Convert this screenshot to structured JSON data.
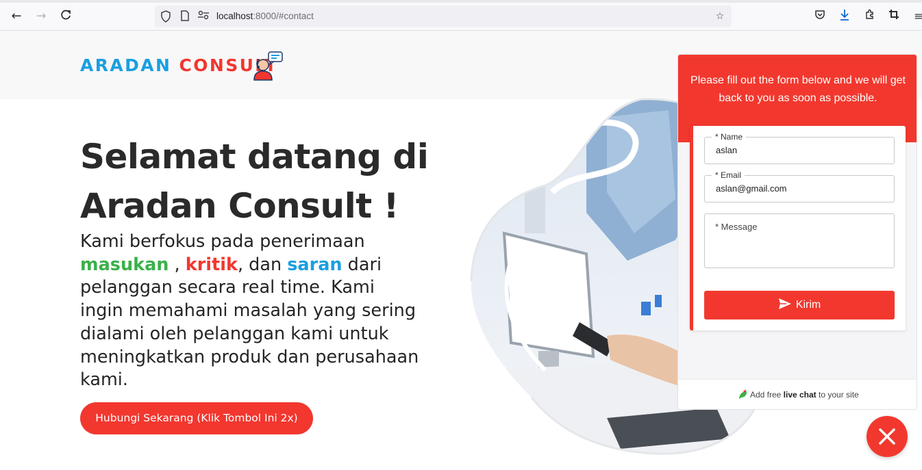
{
  "browser": {
    "url_host": "localhost",
    "url_rest": ":8000/#contact",
    "icons": [
      "back-icon",
      "forward-icon",
      "reload-icon",
      "shield-icon",
      "page-icon",
      "permissions-icon",
      "bookmark-star-icon",
      "pocket-icon",
      "download-icon",
      "extensions-icon",
      "screenshot-icon",
      "menu-icon"
    ]
  },
  "header": {
    "logo_part1": "ARADAN",
    "logo_part2": "CONSULT"
  },
  "hero": {
    "title": "Selamat datang di Aradan Consult !",
    "body_intro": "Kami berfokus pada penerimaan ",
    "kw1": "masukan",
    "sep1": " , ",
    "kw2": "kritik",
    "sep2": ", dan ",
    "kw3": "saran",
    "body_rest": " dari pelanggan secara real time. Kami ingin memahami masalah yang sering dialami oleh pelanggan kami untuk meningkatkan produk dan perusahaan kami.",
    "cta_label": "Hubungi Sekarang (Klik Tombol Ini 2x)"
  },
  "chat": {
    "intro": "Please fill out the form below and we will get back to you as soon as possible.",
    "name_label": "* Name",
    "name_value": "aslan",
    "email_label": "* Email",
    "email_value": "aslan@gmail.com",
    "message_label": "* Message",
    "submit_label": "Kirim",
    "footer_pre": "Add free ",
    "footer_bold": "live chat",
    "footer_post": " to your site"
  },
  "colors": {
    "brand_red": "#f2372f",
    "brand_blue": "#1a9fe0",
    "brand_green": "#3bb04a"
  }
}
